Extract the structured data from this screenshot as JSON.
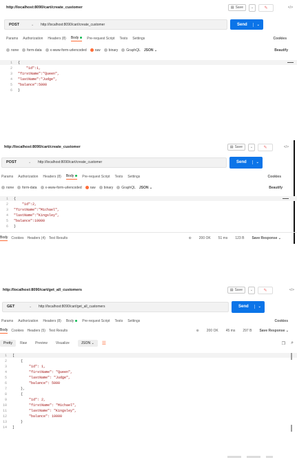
{
  "panels": [
    {
      "url_title": "http://localhost:8090/cart/create_customer",
      "save_label": "Save",
      "method": "POST",
      "url": "http://localhost:8090/cart/create_customer",
      "send_label": "Send",
      "tabs": [
        "Params",
        "Authorization",
        "Headers (8)",
        "Body",
        "Pre-request Script",
        "Tests",
        "Settings"
      ],
      "cookies_label": "Cookies",
      "body_types": [
        "none",
        "form-data",
        "x-www-form-urlencoded",
        "raw",
        "binary",
        "GraphQL"
      ],
      "format_label": "JSON",
      "beautify_label": "Beautify",
      "lines": [
        {
          "n": "1",
          "text": "{"
        },
        {
          "n": "2",
          "text": "    \"id\":1,"
        },
        {
          "n": "3",
          "text": "\"firstName\":\"Queen\","
        },
        {
          "n": "4",
          "text": "\"lastName\":\"Judge\","
        },
        {
          "n": "5",
          "text": "\"balance\":5000"
        },
        {
          "n": "6",
          "text": "}"
        }
      ]
    },
    {
      "url_title": "http://localhost:8090/cart/create_customer",
      "save_label": "Save",
      "method": "POST",
      "url": "http://localhost:8090/cart/create_customer",
      "send_label": "Send",
      "tabs": [
        "Params",
        "Authorization",
        "Headers (8)",
        "Body",
        "Pre-request Script",
        "Tests",
        "Settings"
      ],
      "cookies_label": "Cookies",
      "body_types": [
        "none",
        "form-data",
        "x-www-form-urlencoded",
        "raw",
        "binary",
        "GraphQL"
      ],
      "format_label": "JSON",
      "beautify_label": "Beautify",
      "lines": [
        {
          "n": "1",
          "text": "{"
        },
        {
          "n": "2",
          "text": "    \"id\":2,"
        },
        {
          "n": "3",
          "text": "\"firstName\":\"Michael\","
        },
        {
          "n": "4",
          "text": "\"lastName\":\"Kingsley\","
        },
        {
          "n": "5",
          "text": "\"balance\":10000"
        },
        {
          "n": "6",
          "text": "}"
        }
      ],
      "response_tabs": [
        "Body",
        "Cookies",
        "Headers (4)",
        "Test Results"
      ],
      "status": "200 OK",
      "time": "51 ms",
      "size": "123 B",
      "save_response": "Save Response"
    },
    {
      "url_title": "http://localhost:8090/cart/get_all_customers",
      "save_label": "Save",
      "method": "GET",
      "url": "http://localhost:8090/cart/get_all_customers",
      "send_label": "Send",
      "tabs": [
        "Params",
        "Authorization",
        "Headers (8)",
        "Body",
        "Pre-request Script",
        "Tests",
        "Settings"
      ],
      "cookies_label": "Cookies",
      "response_tabs": [
        "Body",
        "Cookies",
        "Headers (5)",
        "Test Results"
      ],
      "status": "200 OK",
      "time": "45 ms",
      "size": "297 B",
      "save_response": "Save Response",
      "view_modes": [
        "Pretty",
        "Raw",
        "Preview",
        "Visualize"
      ],
      "format_label": "JSON",
      "lines": [
        {
          "n": "1",
          "text": "["
        },
        {
          "n": "2",
          "text": "    {"
        },
        {
          "n": "3",
          "text": "        \"id\": 1,"
        },
        {
          "n": "4",
          "text": "        \"firstName\": \"Queen\","
        },
        {
          "n": "5",
          "text": "        \"lastName\": \"Judge\","
        },
        {
          "n": "6",
          "text": "        \"balance\": 5000"
        },
        {
          "n": "7",
          "text": "    },"
        },
        {
          "n": "8",
          "text": "    {"
        },
        {
          "n": "9",
          "text": "        \"id\": 2,"
        },
        {
          "n": "10",
          "text": "        \"firstName\": \"Michael\","
        },
        {
          "n": "11",
          "text": "        \"lastName\": \"Kingsley\","
        },
        {
          "n": "12",
          "text": "        \"balance\": 10000"
        },
        {
          "n": "13",
          "text": "    }"
        },
        {
          "n": "14",
          "text": "]"
        }
      ]
    }
  ],
  "colors": {
    "accent": "#ff6c37",
    "send": "#0b74e8",
    "status_ok": "#0b8a3e"
  }
}
